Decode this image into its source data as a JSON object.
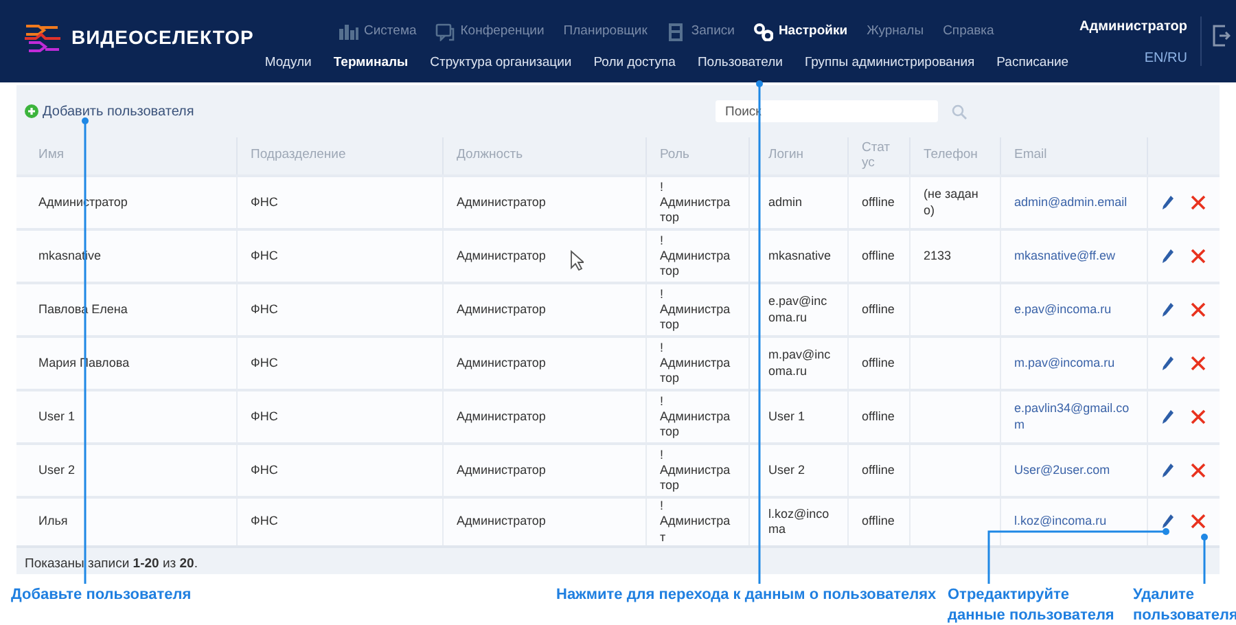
{
  "app": {
    "logo_text": "ВИДЕОСЕЛЕКТОР"
  },
  "main_menu": [
    {
      "label": "Система",
      "selected": false
    },
    {
      "label": "Конференции",
      "selected": false
    },
    {
      "label": "Планировщик",
      "selected": false
    },
    {
      "label": "Записи",
      "selected": false
    },
    {
      "label": "Настройки",
      "selected": true
    },
    {
      "label": "Журналы",
      "selected": false
    },
    {
      "label": "Справка",
      "selected": false
    }
  ],
  "sub_menu": [
    {
      "label": "Модули",
      "selected": false
    },
    {
      "label": "Терминалы",
      "selected": true
    },
    {
      "label": "Структура организации",
      "selected": false
    },
    {
      "label": "Роли доступа",
      "selected": false
    },
    {
      "label": "Пользователи",
      "selected": false
    },
    {
      "label": "Группы администрирования",
      "selected": false
    },
    {
      "label": "Расписание",
      "selected": false
    }
  ],
  "user": {
    "name": "Администратор",
    "language": "EN/RU"
  },
  "toolbar": {
    "add_link": "Добавить пользователя",
    "search": {
      "placeholder": "Поиск"
    }
  },
  "table": {
    "columns": [
      "Имя",
      "Подразделение",
      "Должность",
      "Роль",
      "Логин",
      "Статус",
      "Телефон",
      "Email"
    ],
    "rows": [
      {
        "cells": [
          "Администратор",
          "ФНС",
          "Администратор",
          "!\nАдминистратор",
          "admin",
          "offline",
          "(не задано)",
          "admin@admin.email"
        ]
      },
      {
        "cells": [
          "mkasnative",
          "ФНС",
          "Администратор",
          "!\nАдминистратор",
          "mkasnative",
          "offline",
          "2133",
          "mkasnative@ff.ew"
        ]
      },
      {
        "cells": [
          "Павлова Елена",
          "ФНС",
          "Администратор",
          "!\nАдминистратор",
          "e.pav@incoma.ru",
          "offline",
          "",
          "e.pav@incoma.ru"
        ]
      },
      {
        "cells": [
          "Мария Павлова",
          "ФНС",
          "Администратор",
          "!\nАдминистратор",
          "m.pav@incoma.ru",
          "offline",
          "",
          "m.pav@incoma.ru"
        ]
      },
      {
        "cells": [
          "User 1",
          "ФНС",
          "Администратор",
          "!\nАдминистратор",
          "User 1",
          "offline",
          "",
          "e.pavlin34@gmail.com"
        ]
      },
      {
        "cells": [
          "User 2",
          "ФНС",
          "Администратор",
          "!\nАдминистратор",
          "User 2",
          "offline",
          "",
          "User@2user.com"
        ]
      },
      {
        "cells": [
          "Илья",
          "ФНС",
          "Администратор",
          "!\nАдминистрат",
          "l.koz@incoma",
          "offline",
          "",
          "l.koz@incoma.ru"
        ]
      }
    ]
  },
  "footer": {
    "summary": "Показаны записи **1-20** из **20**."
  },
  "annotations": [
    {
      "text": "Добавьте пользователя"
    },
    {
      "text": "Нажмите для перехода к данным о пользователях"
    },
    {
      "text": "Отредактируйте данные пользователя"
    },
    {
      "text": "Удалите пользователя"
    }
  ]
}
